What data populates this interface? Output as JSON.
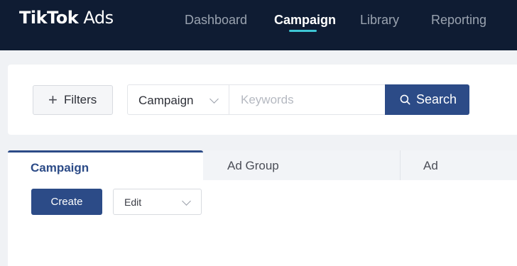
{
  "brand": {
    "name_bold": "TikTok",
    "name_light": " Ads"
  },
  "nav": {
    "items": [
      {
        "label": "Dashboard"
      },
      {
        "label": "Campaign",
        "active": true
      },
      {
        "label": "Library"
      },
      {
        "label": "Reporting"
      }
    ]
  },
  "filters": {
    "filters_label": "Filters",
    "filters_icon": "plus-icon",
    "type_select_value": "Campaign",
    "keyword_placeholder": "Keywords",
    "search_label": "Search",
    "search_icon": "search-icon"
  },
  "tabs": [
    {
      "label": "Campaign",
      "active": true
    },
    {
      "label": "Ad Group"
    },
    {
      "label": "Ad"
    }
  ],
  "toolbar": {
    "create_label": "Create",
    "edit_label": "Edit"
  },
  "colors": {
    "topbar": "#0f1c33",
    "primary": "#2c4b87",
    "nav_accent": "#3ec6d4",
    "page_background": "#f0f2f5"
  }
}
